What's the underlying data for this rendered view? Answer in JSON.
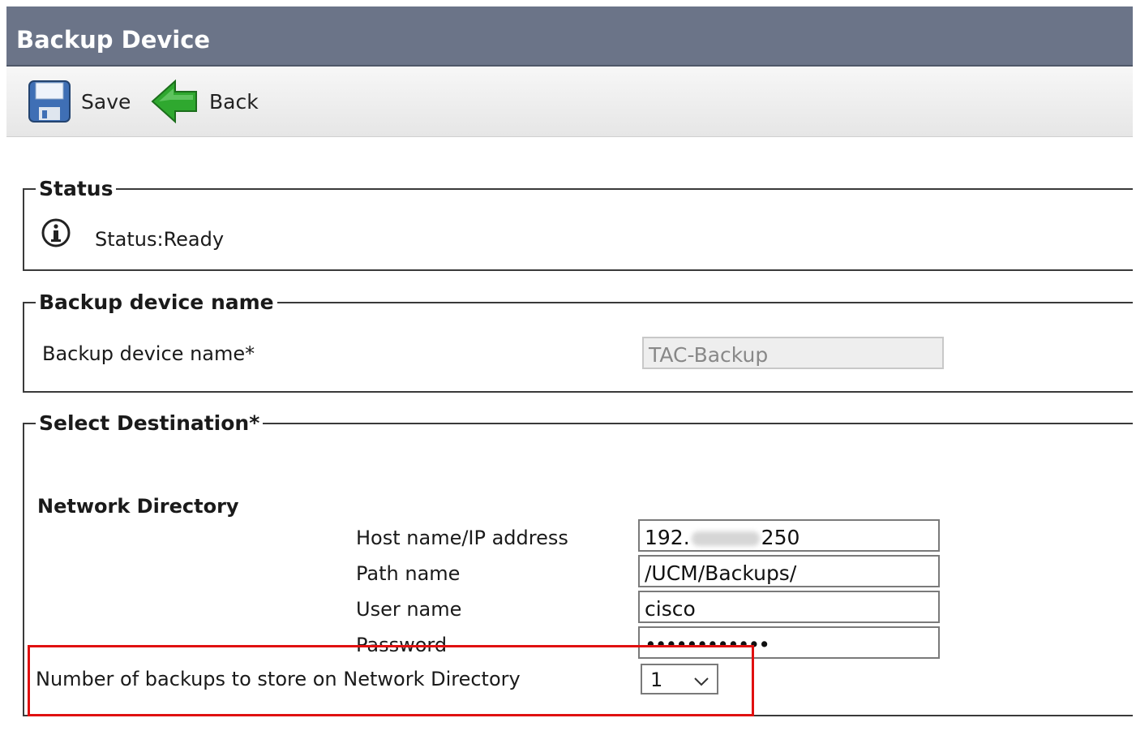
{
  "header": {
    "title": "Backup Device"
  },
  "toolbar": {
    "save_label": "Save",
    "back_label": "Back",
    "save_icon": "floppy-disk-icon",
    "back_icon": "green-arrow-left-icon"
  },
  "status_section": {
    "legend": "Status",
    "icon": "info-icon",
    "text": "Status:Ready"
  },
  "name_section": {
    "legend": "Backup device name",
    "label": "Backup device name*",
    "value": "TAC-Backup"
  },
  "destination_section": {
    "legend": "Select Destination*",
    "subheading": "Network Directory",
    "host_label": "Host name/IP address",
    "host_value_prefix": "192.",
    "host_value_suffix": "250",
    "path_label": "Path name",
    "path_value": "/UCM/Backups/",
    "user_label": "User name",
    "user_value": "cisco",
    "password_label": "Password",
    "password_value": "••••••••••••",
    "backups_label": "Number of backups to store on Network Directory",
    "backups_value": "1"
  },
  "colors": {
    "title_bar": "#6b7488",
    "highlight": "#e01010",
    "back_arrow": "#2fa82f"
  }
}
